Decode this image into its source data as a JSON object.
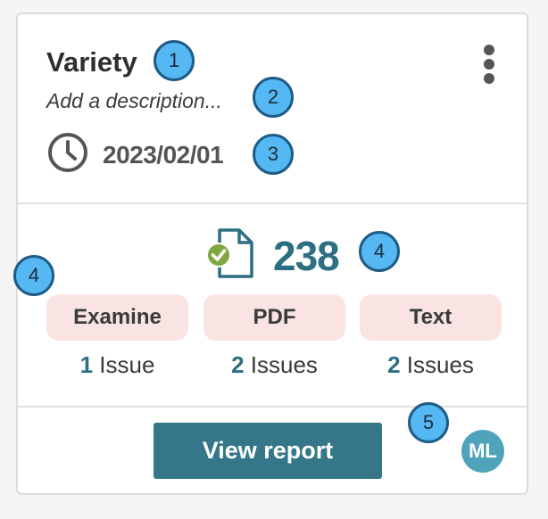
{
  "card": {
    "title": "Variety",
    "description_placeholder": "Add a description...",
    "date": "2023/02/01",
    "menu_icon": "kebab-menu-icon",
    "date_icon": "clock-icon"
  },
  "stats": {
    "document_icon": "document-check-icon",
    "count": "238"
  },
  "categories": [
    {
      "label": "Examine",
      "issue_count": "1",
      "issue_label": "Issue"
    },
    {
      "label": "PDF",
      "issue_count": "2",
      "issue_label": "Issues"
    },
    {
      "label": "Text",
      "issue_count": "2",
      "issue_label": "Issues"
    }
  ],
  "footer": {
    "button_label": "View report",
    "avatar_initials": "ML"
  },
  "markers": [
    "1",
    "2",
    "3",
    "4",
    "4",
    "5"
  ],
  "colors": {
    "accent": "#357788",
    "count_text": "#2c6f82",
    "pill_bg": "#f9e3e3",
    "marker_fill": "#55b8f2",
    "check_green": "#7fa843",
    "avatar_bg": "#4fa3bb"
  }
}
